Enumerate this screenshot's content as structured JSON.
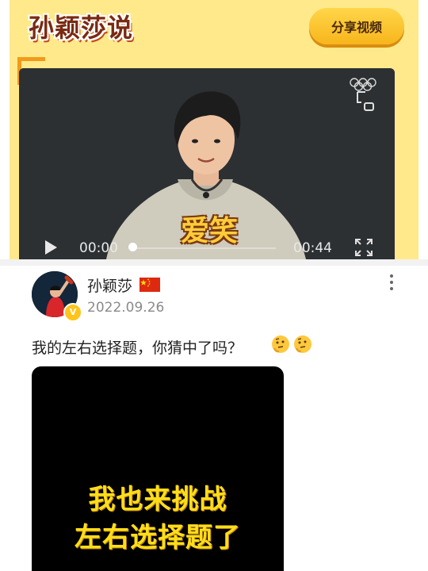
{
  "banner": {
    "title": "孙颖莎说",
    "share_label": "分享视频"
  },
  "video": {
    "subtitle": "爱笑",
    "time_current": "00:00",
    "time_total": "00:44",
    "progress": 0
  },
  "post": {
    "author": "孙颖莎",
    "date": "2022.09.26",
    "text": "我的左右选择题，你猜中了吗？",
    "emoji_count": 2
  },
  "thumbnail": {
    "line1": "我也来挑战",
    "line2": "左右选择题了"
  },
  "colors": {
    "banner_bg": "#ffe98a",
    "accent_orange": "#f29a1a",
    "subtitle_yellow": "#ffcc3a",
    "thumb_text_yellow": "#ffdd1a"
  },
  "icons": [
    "olympic-rings-icon",
    "pip-icon",
    "play-icon",
    "fullscreen-icon",
    "china-flag-icon",
    "more-vertical-icon",
    "verified-icon",
    "thinking-face-emoji"
  ]
}
